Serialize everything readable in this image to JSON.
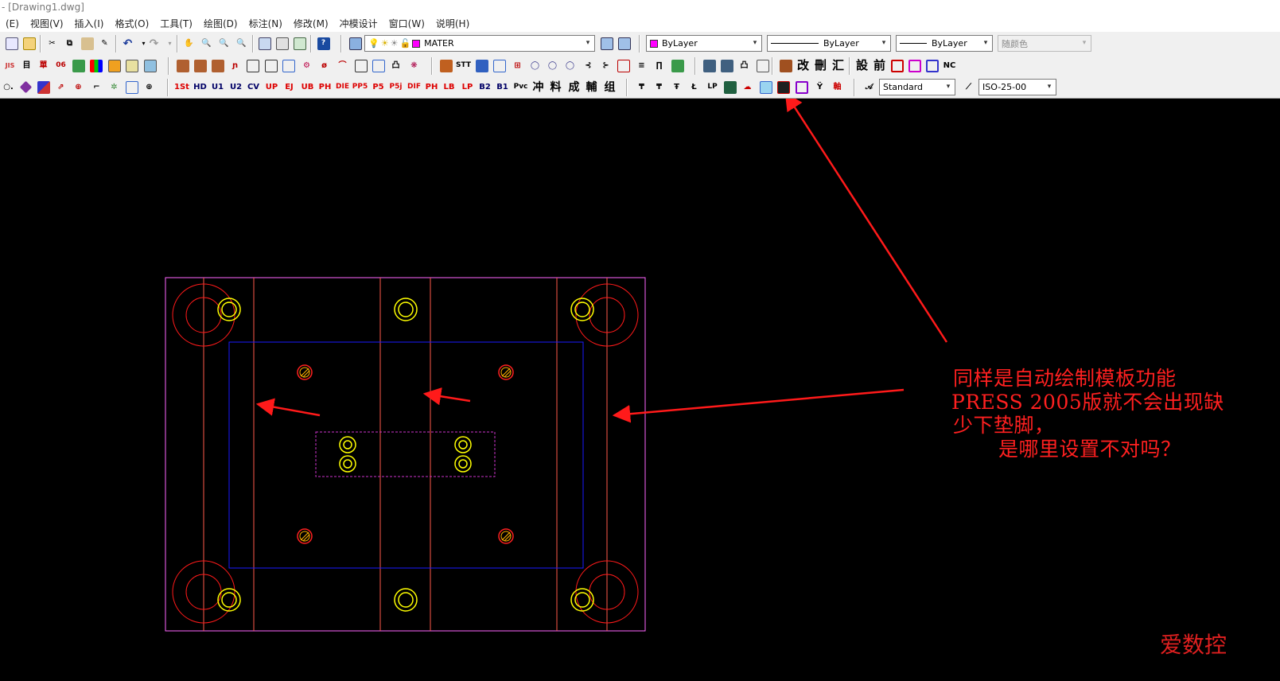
{
  "window": {
    "title": "- [Drawing1.dwg]"
  },
  "menu": [
    "(E)",
    "视图(V)",
    "插入(I)",
    "格式(O)",
    "工具(T)",
    "绘图(D)",
    "标注(N)",
    "修改(M)",
    "冲模设计",
    "窗口(W)",
    "说明(H)"
  ],
  "toolbar": {
    "layer_combo": "MATER",
    "color_combo": "ByLayer",
    "linetype_combo": "ByLayer",
    "lineweight_combo": "ByLayer",
    "plotstyle_combo": "随颜色",
    "text_style_combo": "Standard",
    "dim_style_combo": "ISO-25-00",
    "row3_icons": [
      "1St",
      "HD",
      "U1",
      "U2",
      "CV",
      "UP",
      "EJ",
      "UB",
      "PH",
      "DIE",
      "PP5",
      "P5",
      "P5j",
      "DIF",
      "PH",
      "LB",
      "LP",
      "B2",
      "B1",
      "Pvc",
      "冲",
      "料",
      "成",
      "輔",
      "组"
    ],
    "row2_icons": [
      "STT",
      "設",
      "前",
      "NC",
      "改",
      "刪",
      "汇"
    ]
  },
  "canvas": {
    "annotation": [
      "同样是自动绘制模板功能",
      "PRESS 2005版就不会出现缺",
      "少下垫脚，",
      "是哪里设置不对吗？"
    ],
    "watermark": "爱数控",
    "colors": {
      "background": "#000000",
      "annotation": "#ff2020",
      "plate_outline": "#ff66ff",
      "spacer_lines": "#ff5040",
      "inner_rect": "#0000ff",
      "holes": "#ffff00",
      "large_circles": "#ff0000"
    }
  }
}
